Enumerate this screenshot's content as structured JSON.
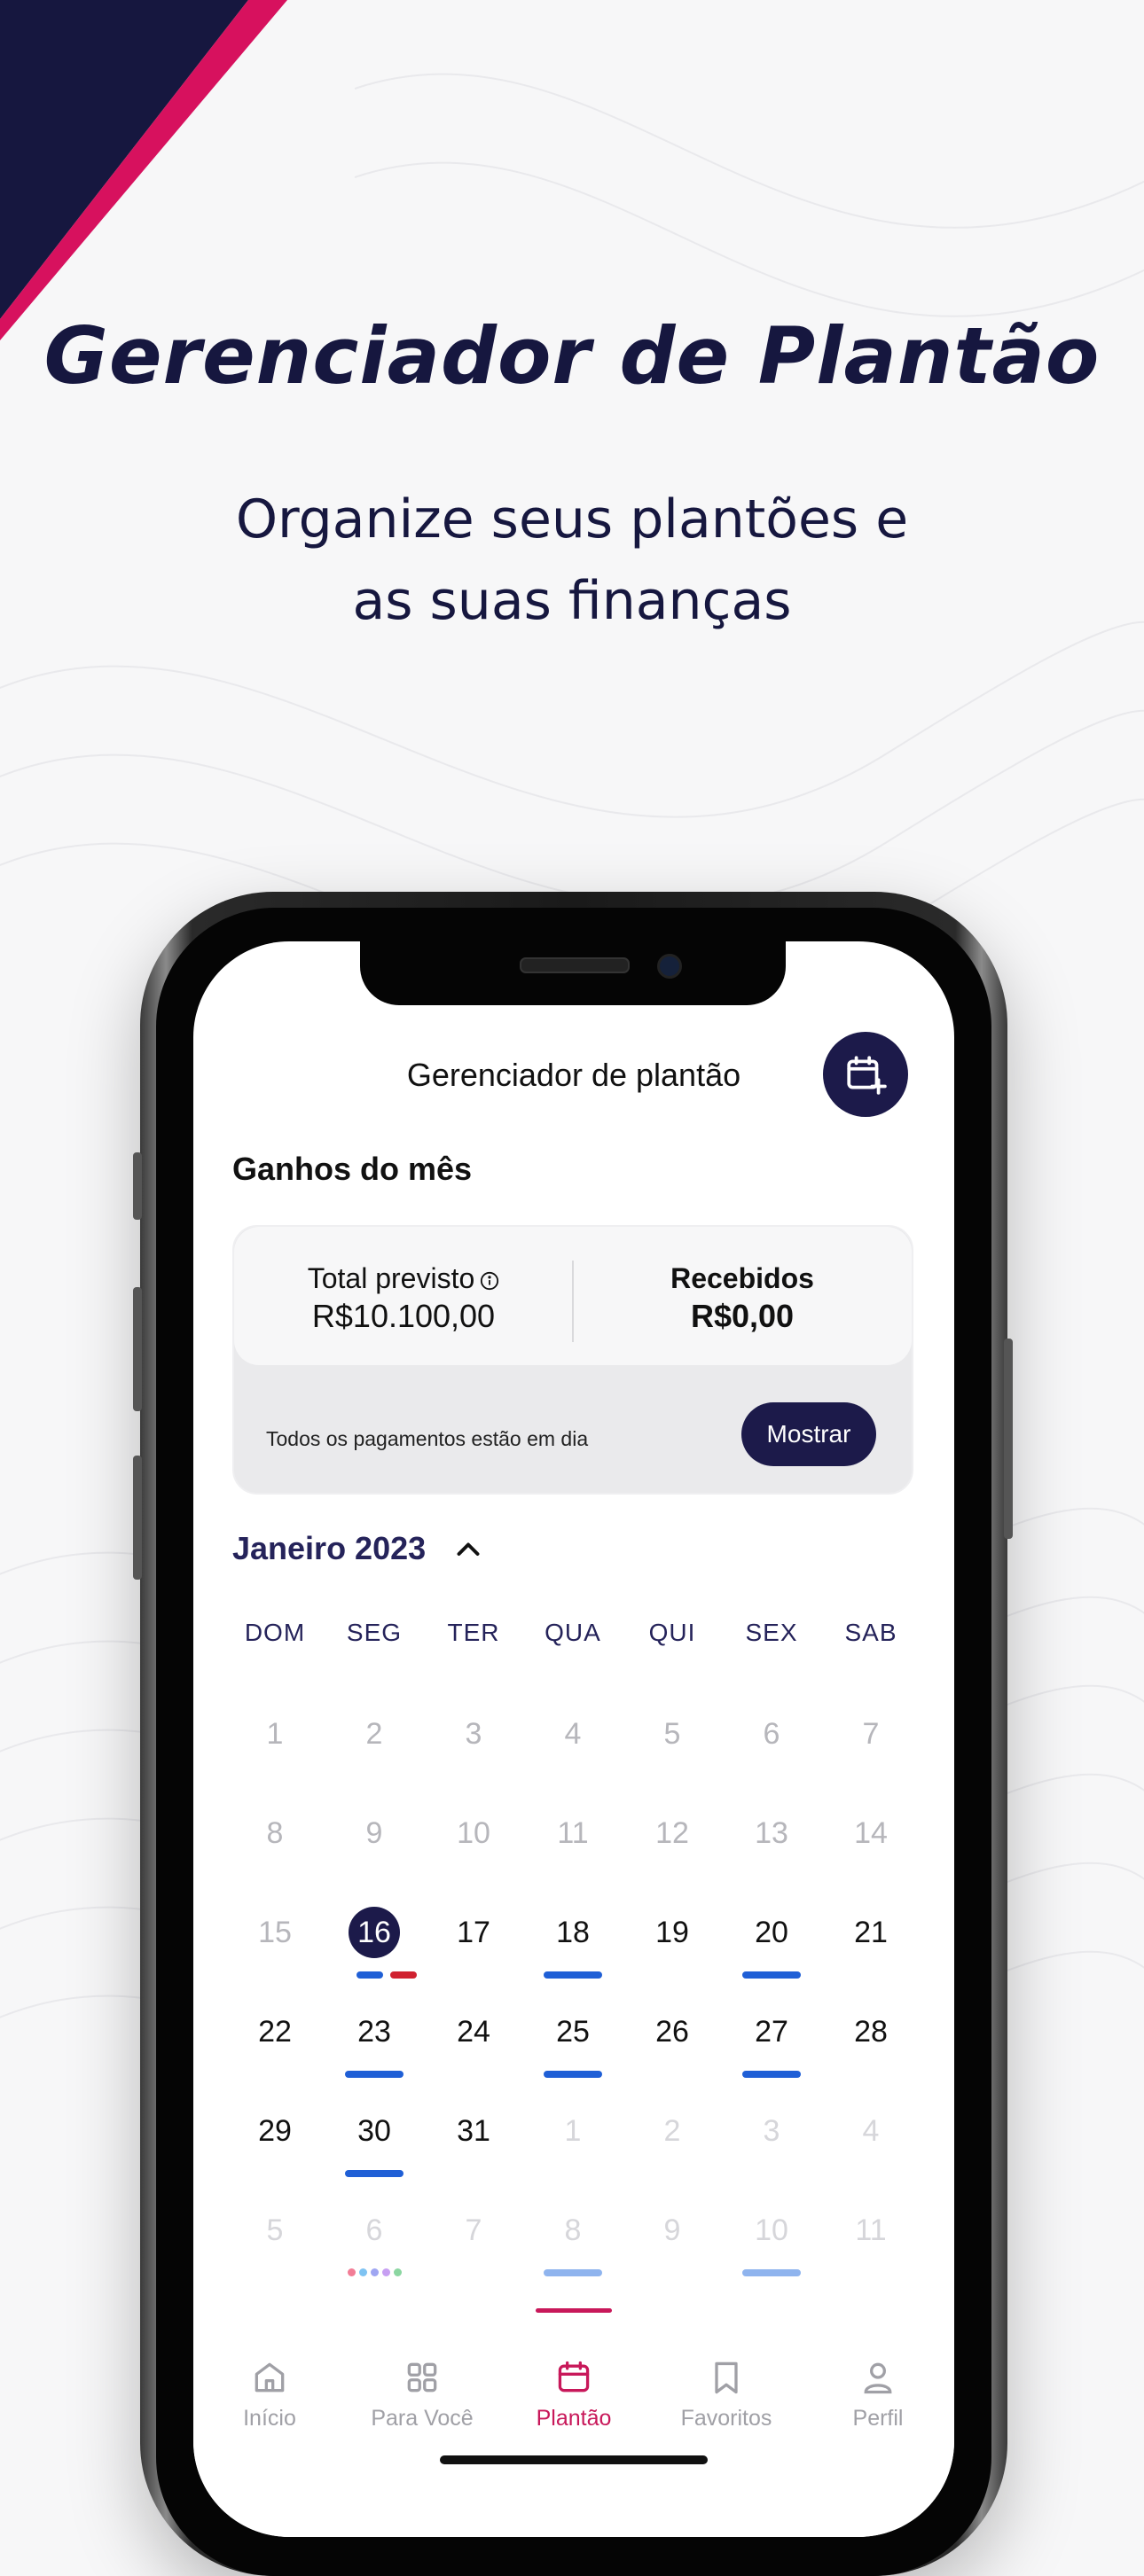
{
  "headline": "Gerenciador de Plantão",
  "subline": [
    "Organize seus plantões e",
    "as suas finanças"
  ],
  "colors": {
    "navy": "#1c1a4a",
    "magenta": "#d7115e",
    "blue": "#1f5fd6",
    "red": "#d02130",
    "inactive_tab": "#a0a0a6"
  },
  "app": {
    "title": "Gerenciador de plantão",
    "add_icon": "calendar-plus-icon",
    "earnings": {
      "section_title": "Ganhos do mês",
      "total_label": "Total previsto",
      "total_value": "R$10.100,00",
      "received_label": "Recebidos",
      "received_value": "R$0,00",
      "note": "Todos os pagamentos estão em dia",
      "show_button": "Mostrar"
    },
    "calendar": {
      "month": "Janeiro 2023",
      "weekdays": [
        "DOM",
        "SEG",
        "TER",
        "QUA",
        "QUI",
        "SEX",
        "SAB"
      ],
      "weeks": [
        [
          "1",
          "2",
          "3",
          "4",
          "5",
          "6",
          "7"
        ],
        [
          "8",
          "9",
          "10",
          "11",
          "12",
          "13",
          "14"
        ],
        [
          "15",
          "16",
          "17",
          "18",
          "19",
          "20",
          "21"
        ],
        [
          "22",
          "23",
          "24",
          "25",
          "26",
          "27",
          "28"
        ],
        [
          "29",
          "30",
          "31",
          "1",
          "2",
          "3",
          "4"
        ],
        [
          "5",
          "6",
          "7",
          "8",
          "9",
          "10",
          "11"
        ]
      ],
      "selected_day": "16"
    },
    "tabs": [
      {
        "label": "Início",
        "icon": "home-icon"
      },
      {
        "label": "Para Você",
        "icon": "grid-icon"
      },
      {
        "label": "Plantão",
        "icon": "calendar-icon",
        "active": true
      },
      {
        "label": "Favoritos",
        "icon": "bookmark-icon"
      },
      {
        "label": "Perfil",
        "icon": "user-icon"
      }
    ]
  }
}
